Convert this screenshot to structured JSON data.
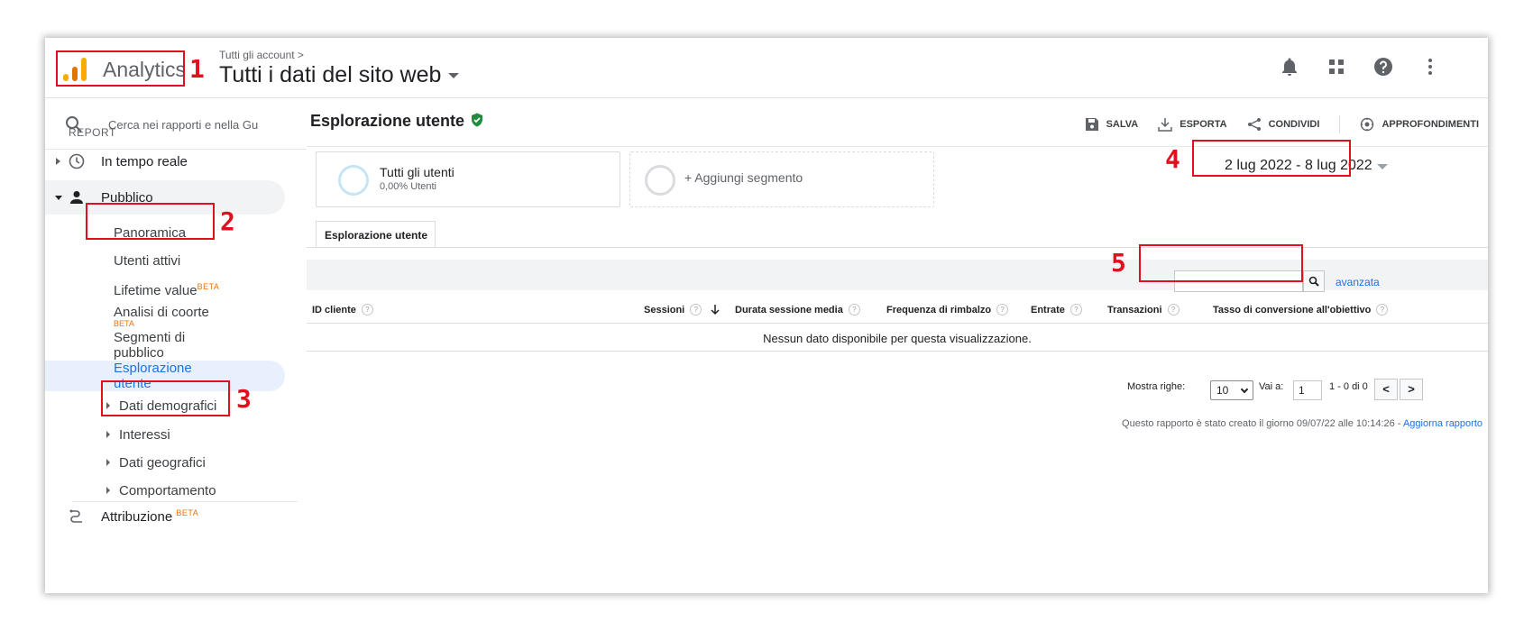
{
  "app": {
    "name": "Analytics",
    "breadcrumb": "Tutti gli account >",
    "property": "Tutti i dati del sito web",
    "logo_colors": [
      "#f9ab00",
      "#e37400",
      "#f9ab00"
    ]
  },
  "header_icons": [
    "bell-icon",
    "apps-grid-icon",
    "help-icon",
    "more-vert-icon"
  ],
  "sidebar": {
    "search_placeholder": "Cerca nei rapporti e nella Gu",
    "section_label": "REPORT",
    "realtime_label": "In tempo reale",
    "audience_label": "Pubblico",
    "audience_items": {
      "overview": "Panoramica",
      "active_users": "Utenti attivi",
      "lifetime_value": "Lifetime value",
      "lifetime_badge": "BETA",
      "cohort": "Analisi di coorte",
      "cohort_badge": "BETA",
      "segments": "Segmenti di pubblico",
      "explorer": "Esplorazione utente",
      "demographics": "Dati demografici",
      "interests": "Interessi",
      "geo": "Dati geografici",
      "behavior": "Comportamento"
    },
    "attribution_label": "Attribuzione",
    "attribution_badge": "BETA"
  },
  "main": {
    "title": "Esplorazione utente",
    "toolbar": {
      "save": "SALVA",
      "export": "ESPORTA",
      "share": "CONDIVIDI",
      "insights": "APPROFONDIMENTI"
    },
    "segment": {
      "name": "Tutti gli utenti",
      "sub": "0,00% Utenti",
      "add": "+ Aggiungi segmento"
    },
    "date_range": "2 lug 2022 - 8 lug 2022",
    "tab_label": "Esplorazione utente",
    "filter": {
      "value": "",
      "advanced": "avanzata"
    },
    "columns": {
      "client_id": "ID cliente",
      "sessions": "Sessioni",
      "avg_duration": "Durata sessione media",
      "bounce_rate": "Frequenza di rimbalzo",
      "revenue": "Entrate",
      "transactions": "Transazioni",
      "goal_conversion": "Tasso di conversione all'obiettivo"
    },
    "empty_message": "Nessun dato disponibile per questa visualizzazione.",
    "pager": {
      "show_rows_label": "Mostra righe:",
      "rows_value": "10",
      "goto_label": "Vai a:",
      "goto_value": "1",
      "range": "1 - 0 di 0",
      "prev": "<",
      "next": ">"
    },
    "footer": {
      "note": "Questo rapporto è stato creato il giorno 09/07/22 alle 10:14:26 -",
      "refresh": "Aggiorna rapporto"
    }
  },
  "annotations": [
    "1",
    "2",
    "3",
    "4",
    "5"
  ],
  "colors": {
    "annotation_red": "#e0101f",
    "accent_blue": "#1a73e8",
    "verified_green": "#1e8e3e",
    "selected_bg": "#e8f0fe"
  }
}
